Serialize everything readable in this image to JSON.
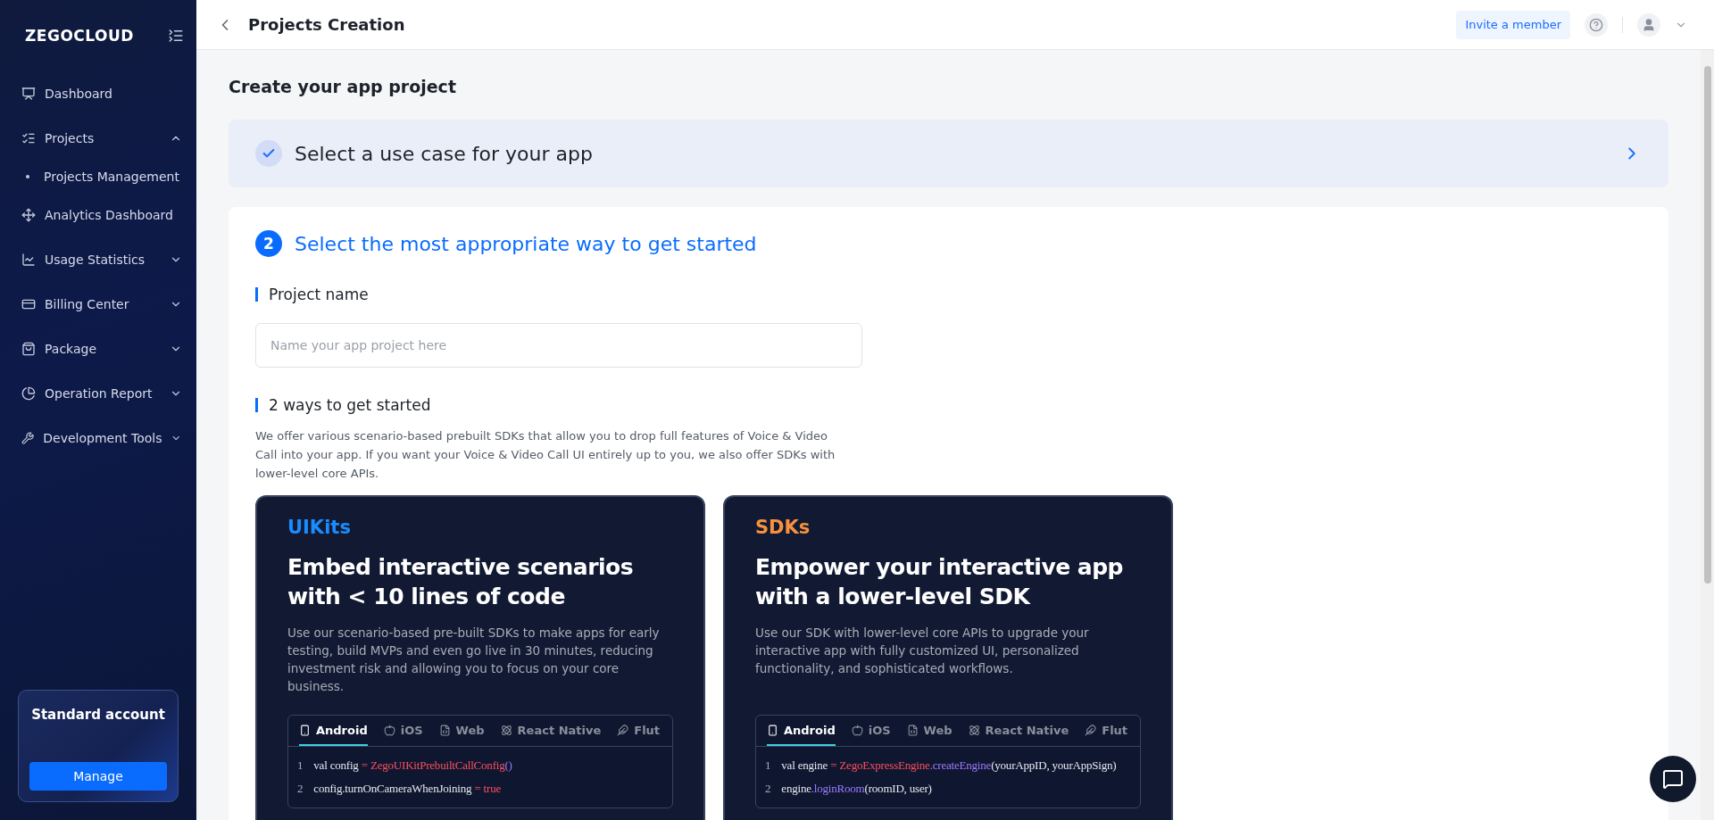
{
  "sidebar": {
    "logo": "ZEGOCLOUD",
    "items": [
      {
        "label": "Dashboard"
      },
      {
        "label": "Projects",
        "expanded": true,
        "children": [
          {
            "label": "Projects Management"
          }
        ]
      },
      {
        "label": "Analytics Dashboard"
      },
      {
        "label": "Usage Statistics",
        "expanded": false
      },
      {
        "label": "Billing Center",
        "expanded": false
      },
      {
        "label": "Package",
        "expanded": false
      },
      {
        "label": "Operation Report",
        "expanded": false
      },
      {
        "label": "Development Tools",
        "expanded": false
      }
    ],
    "account": {
      "title": "Standard account",
      "button": "Manage"
    }
  },
  "header": {
    "title": "Projects Creation",
    "invite": "Invite a member"
  },
  "page_title": "Create your app project",
  "steps": [
    {
      "title": "Select a use case for your app",
      "done": true
    },
    {
      "title": "Select the most appropriate way to get started",
      "done": false,
      "number": "2"
    }
  ],
  "project_name": {
    "label": "Project name",
    "placeholder": "Name your app project here"
  },
  "ways": {
    "label": "2 ways to get started",
    "description": "We offer various scenario-based prebuilt SDKs that allow you to drop full features of Voice & Video Call into your app. If you want your Voice & Video Call UI entirely up to you, we also offer SDKs with lower-level core APIs."
  },
  "cards": [
    {
      "tag": "UIKits",
      "color": "#1b8cff",
      "heading": "Embed interactive scenarios with < 10 lines of code",
      "body": "Use our scenario-based pre-built SDKs to make apps for early testing, build MVPs and even go live in 30 minutes, reducing investment risk and allowing you to focus on your core business.",
      "tabs": [
        {
          "label": "Android",
          "selected": true
        },
        {
          "label": "iOS",
          "selected": false
        },
        {
          "label": "Web",
          "selected": false
        },
        {
          "label": "React Native",
          "selected": false
        },
        {
          "label": "Flut",
          "selected": false
        }
      ],
      "code": [
        {
          "number": "1",
          "parts": [
            {
              "text": "val config ",
              "kind": "plain"
            },
            {
              "text": "= ZegoUIKitPrebuiltCallConfig",
              "kind": "class"
            },
            {
              "text": "()",
              "kind": "method"
            }
          ]
        },
        {
          "number": "2",
          "parts": [
            {
              "text": "config.turnOnCameraWhenJoining ",
              "kind": "plain"
            },
            {
              "text": "= true",
              "kind": "class"
            }
          ]
        }
      ]
    },
    {
      "tag": "SDKs",
      "color": "#f7913d",
      "heading": "Empower your interactive app with a lower-level SDK",
      "body": "Use our SDK with lower-level core APIs to upgrade your interactive app with fully customized UI, personalized functionality, and sophisticated workflows.",
      "tabs": [
        {
          "label": "Android",
          "selected": true
        },
        {
          "label": "iOS",
          "selected": false
        },
        {
          "label": "Web",
          "selected": false
        },
        {
          "label": "React Native",
          "selected": false
        },
        {
          "label": "Flut",
          "selected": false
        }
      ],
      "code": [
        {
          "number": "1",
          "parts": [
            {
              "text": "val engine ",
              "kind": "plain"
            },
            {
              "text": "= ZegoExpressEngine",
              "kind": "class"
            },
            {
              "text": ".createEngine",
              "kind": "method"
            },
            {
              "text": "(yourAppID, yourAppSign)",
              "kind": "plain"
            }
          ]
        },
        {
          "number": "2",
          "parts": [
            {
              "text": "engine",
              "kind": "plain"
            },
            {
              "text": ".loginRoom",
              "kind": "method"
            },
            {
              "text": "(roomID, user)",
              "kind": "plain"
            }
          ]
        }
      ]
    }
  ]
}
